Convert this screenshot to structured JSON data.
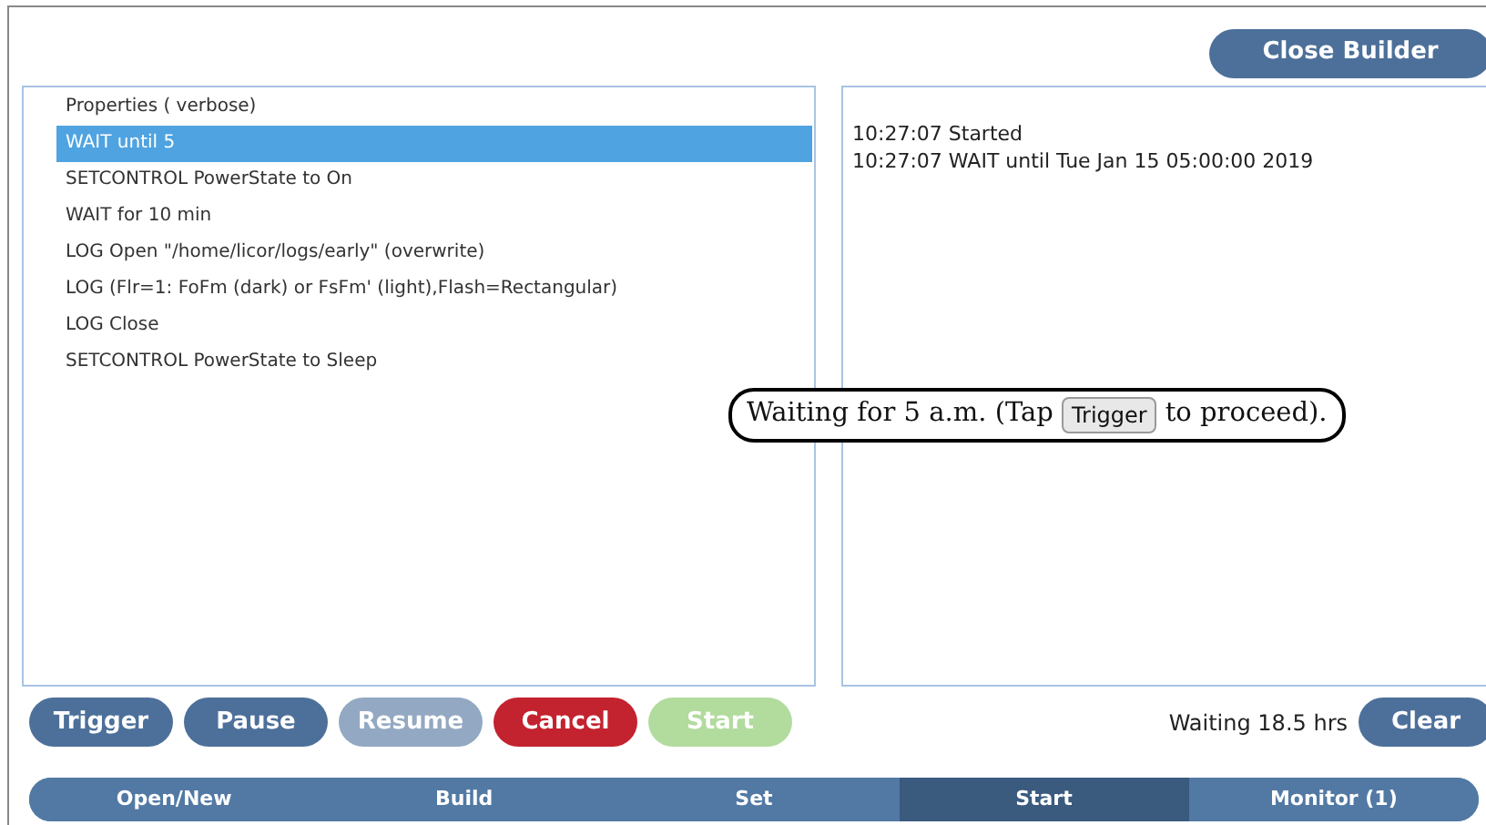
{
  "header": {
    "close_button": "Close Builder"
  },
  "program_list": [
    {
      "label": "Properties ( verbose)",
      "selected": false
    },
    {
      "label": "WAIT until 5",
      "selected": true
    },
    {
      "label": "SETCONTROL PowerState to On",
      "selected": false
    },
    {
      "label": "WAIT for 10 min",
      "selected": false
    },
    {
      "label": "LOG Open \"/home/licor/logs/early\" (overwrite)",
      "selected": false
    },
    {
      "label": "LOG (Flr=1: FoFm (dark) or FsFm' (light),Flash=Rectangular)",
      "selected": false
    },
    {
      "label": "LOG Close",
      "selected": false
    },
    {
      "label": "SETCONTROL PowerState to Sleep",
      "selected": false
    }
  ],
  "log_lines": [
    "10:27:07 Started",
    "10:27:07 WAIT until Tue Jan 15 05:00:00 2019"
  ],
  "callout": {
    "before": "Waiting for 5 a.m. (Tap",
    "key": "Trigger",
    "after": "to proceed)."
  },
  "actions": [
    {
      "label": "Trigger",
      "kind": "primary",
      "disabled": false
    },
    {
      "label": "Pause",
      "kind": "primary",
      "disabled": false
    },
    {
      "label": "Resume",
      "kind": "primary",
      "disabled": true
    },
    {
      "label": "Cancel",
      "kind": "danger",
      "disabled": false
    },
    {
      "label": "Start",
      "kind": "success",
      "disabled": true
    }
  ],
  "status": "Waiting 18.5 hrs",
  "clear_button": "Clear",
  "tabs": [
    {
      "label": "Open/New",
      "selected": false
    },
    {
      "label": "Build",
      "selected": false
    },
    {
      "label": "Set",
      "selected": false
    },
    {
      "label": "Start",
      "selected": true
    },
    {
      "label": "Monitor (1)",
      "selected": false
    }
  ]
}
